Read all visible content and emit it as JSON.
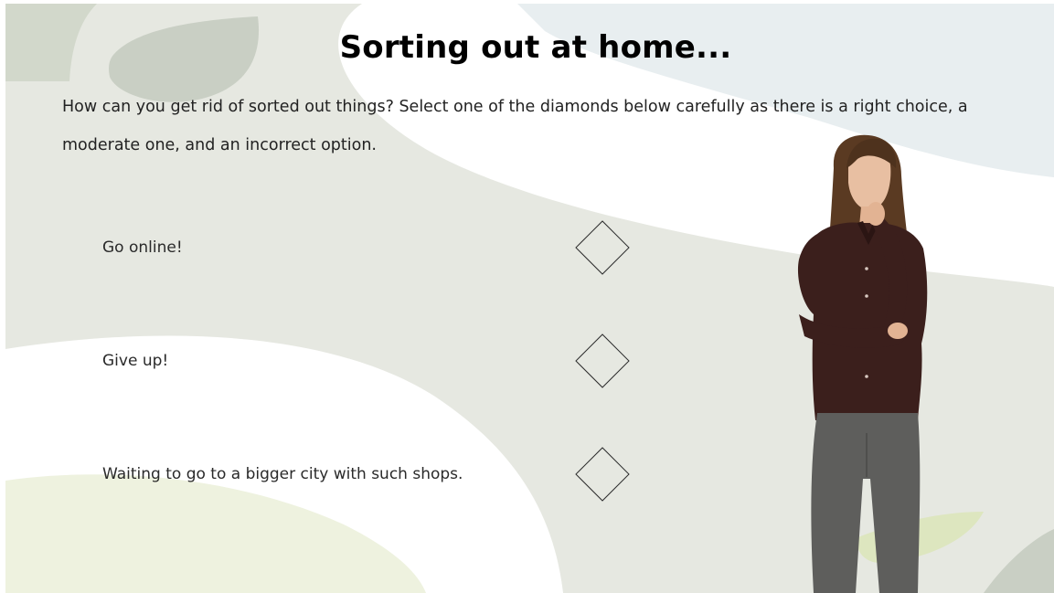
{
  "slide": {
    "title": "Sorting out at home...",
    "instructions": "How can you get rid of sorted out things? Select one of the diamonds below carefully as there is a right choice, a moderate one, and an incorrect option.",
    "options": [
      {
        "label": "Go online!"
      },
      {
        "label": "Give up!"
      },
      {
        "label": "Waiting to go to a bigger city with such shops."
      }
    ]
  },
  "colors": {
    "background": "#ffffff",
    "sage": "#e6e8e1",
    "sage_dark": "#c9cfc4",
    "blue_grey": "#e8eef0",
    "lime_light": "#eef2df",
    "lime": "#dde6bf",
    "diamond_stroke": "#2b2b2b",
    "text": "#222222"
  },
  "icons": {
    "choice": "diamond-outline-icon",
    "character": "thinking-woman-character"
  }
}
